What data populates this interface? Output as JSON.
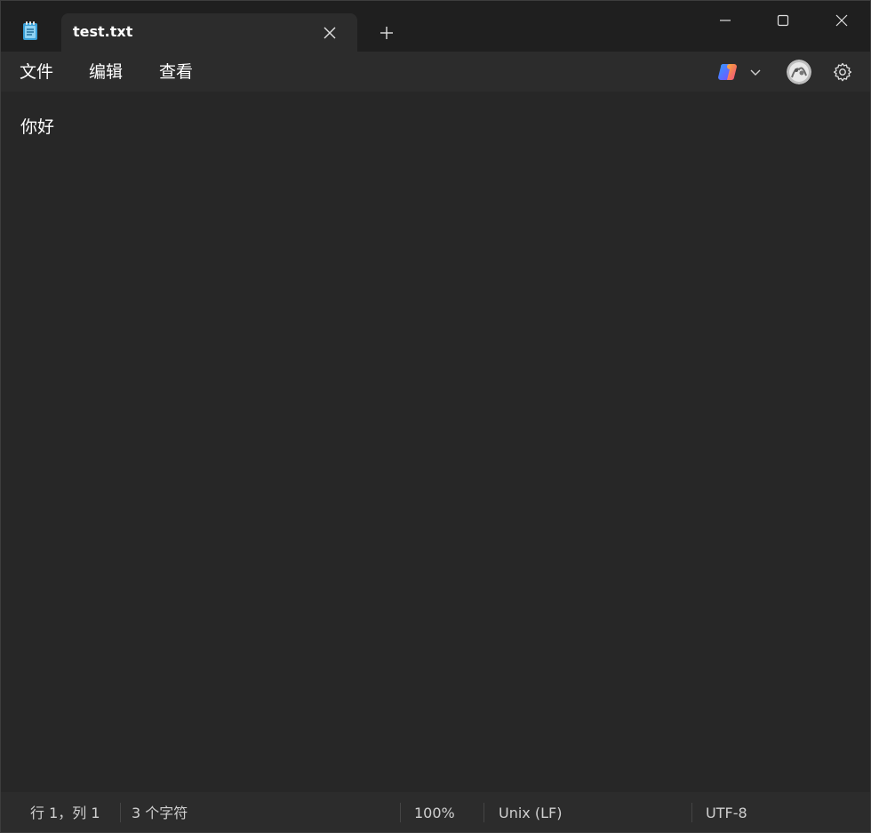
{
  "tab": {
    "title": "test.txt"
  },
  "menu": {
    "file": "文件",
    "edit": "编辑",
    "view": "查看"
  },
  "editor": {
    "content": "你好"
  },
  "status": {
    "position": "行 1，列 1",
    "chars": "3 个字符",
    "zoom": "100%",
    "line_ending": "Unix (LF)",
    "encoding": "UTF-8"
  },
  "colors": {
    "background": "#272727",
    "titlebar": "#1f1f1f",
    "bars": "#2c2c2c",
    "text": "#ffffff",
    "muted_text": "#cfcfcf"
  },
  "icons": {
    "app": "notepad-icon",
    "tab_close": "close-icon",
    "new_tab": "plus-icon",
    "minimize": "minimize-icon",
    "maximize": "maximize-icon",
    "close": "close-icon",
    "copilot": "copilot-icon",
    "copilot_menu": "chevron-down-icon",
    "account": "avatar",
    "settings": "gear-icon"
  }
}
